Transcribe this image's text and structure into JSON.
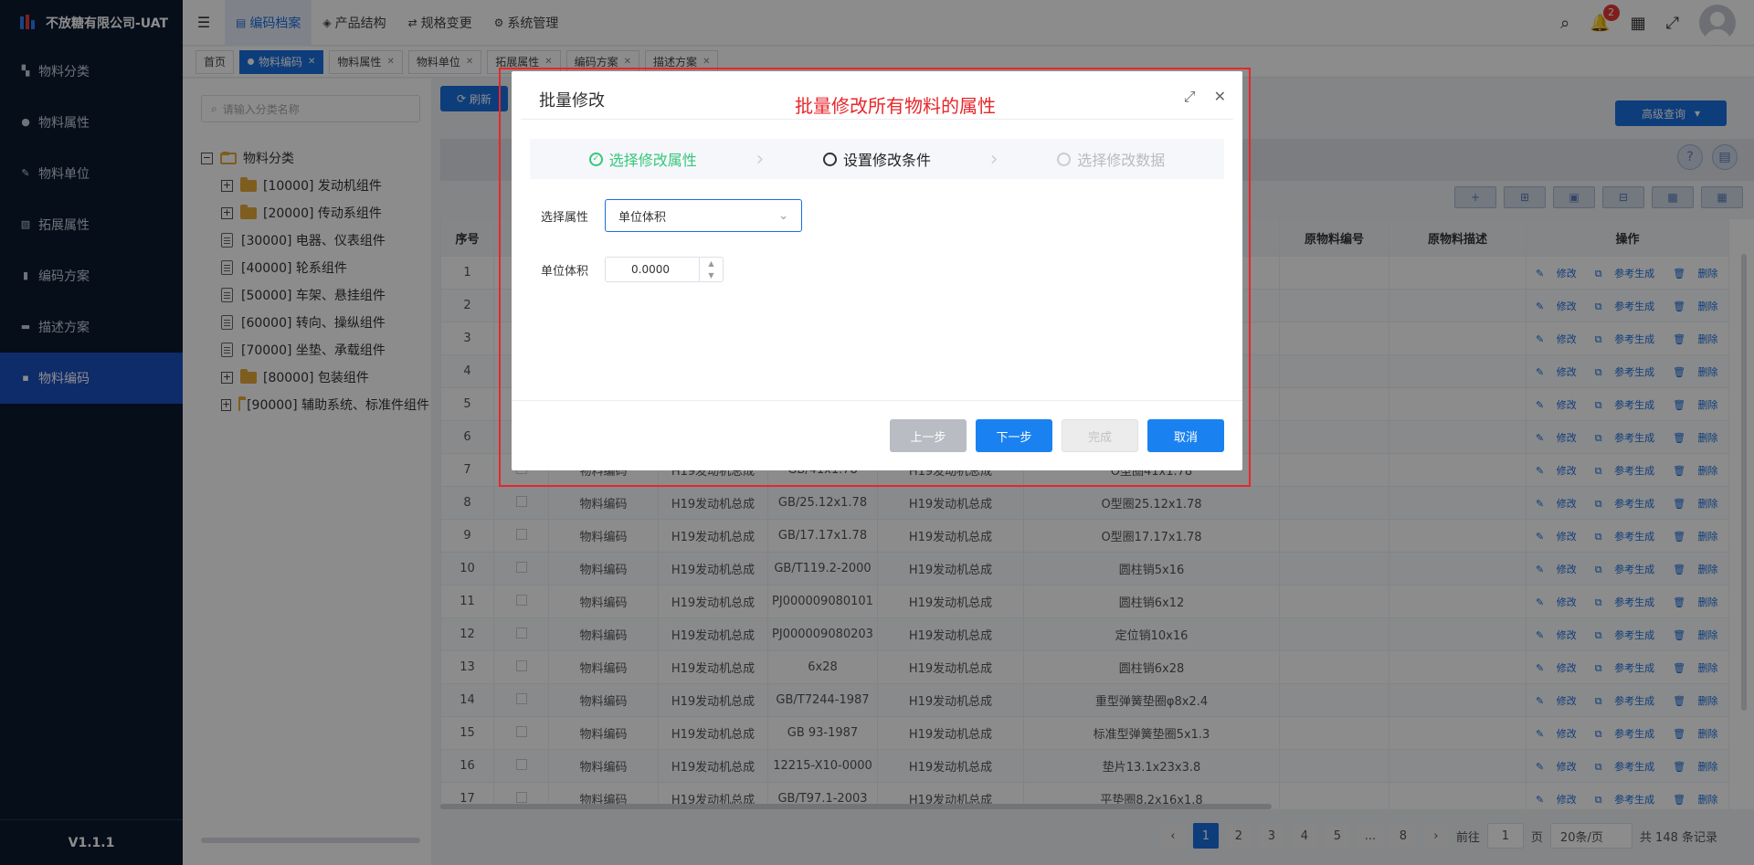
{
  "app": {
    "name": "不放糖有限公司-UAT",
    "version": "V1.1.1"
  },
  "sidebar": {
    "items": [
      {
        "label": "物料分类",
        "icon": "grid-icon"
      },
      {
        "label": "物料属性",
        "icon": "info-icon"
      },
      {
        "label": "物料单位",
        "icon": "ruler-icon"
      },
      {
        "label": "拓展属性",
        "icon": "extend-icon"
      },
      {
        "label": "编码方案",
        "icon": "code-icon"
      },
      {
        "label": "描述方案",
        "icon": "desc-icon"
      },
      {
        "label": "物料编码",
        "icon": "doc-icon",
        "active": true
      }
    ]
  },
  "topnav": {
    "tabs": [
      {
        "label": "编码档案",
        "active": true
      },
      {
        "label": "产品结构"
      },
      {
        "label": "规格变更"
      },
      {
        "label": "系统管理"
      }
    ],
    "notification_count": "2"
  },
  "tags": [
    {
      "label": "首页"
    },
    {
      "label": "物料编码",
      "active": true
    },
    {
      "label": "物料属性"
    },
    {
      "label": "物料单位"
    },
    {
      "label": "拓展属性"
    },
    {
      "label": "编码方案"
    },
    {
      "label": "描述方案"
    }
  ],
  "tree": {
    "search_placeholder": "请输入分类名称",
    "root": "物料分类",
    "nodes": [
      {
        "label": "[10000] 发动机组件",
        "type": "folder"
      },
      {
        "label": "[20000] 传动系组件",
        "type": "folder"
      },
      {
        "label": "[30000] 电器、仪表组件",
        "type": "file"
      },
      {
        "label": "[40000] 轮系组件",
        "type": "file"
      },
      {
        "label": "[50000] 车架、悬挂组件",
        "type": "file"
      },
      {
        "label": "[60000] 转向、操纵组件",
        "type": "file"
      },
      {
        "label": "[70000] 坐垫、承载组件",
        "type": "file"
      },
      {
        "label": "[80000] 包装组件",
        "type": "folder"
      },
      {
        "label": "[90000] 辅助系统、标准件组件",
        "type": "folder"
      }
    ]
  },
  "toolbar": {
    "refresh": "刷新",
    "advanced_query": "高级查询"
  },
  "table": {
    "columns": [
      "序号",
      "",
      "",
      "",
      "",
      "",
      "",
      "原物料编号",
      "原物料描述",
      "操作"
    ],
    "op_labels": [
      "修改",
      "参考生成",
      "删除"
    ],
    "rows": [
      {
        "no": "1",
        "c1": "",
        "c2": "",
        "c3": "",
        "c4": "",
        "c5": ""
      },
      {
        "no": "2",
        "c1": "",
        "c2": "",
        "c3": "",
        "c4": "",
        "c5": ""
      },
      {
        "no": "3",
        "c1": "",
        "c2": "",
        "c3": "",
        "c4": "",
        "c5": ""
      },
      {
        "no": "4",
        "c1": "",
        "c2": "",
        "c3": "",
        "c4": "",
        "c5": ""
      },
      {
        "no": "5",
        "c1": "",
        "c2": "",
        "c3": "",
        "c4": "",
        "c5": ""
      },
      {
        "no": "6",
        "c1": "",
        "c2": "",
        "c3": "",
        "c4": "",
        "c5": ""
      },
      {
        "no": "7",
        "c1": "物料编码",
        "c2": "H19发动机总成",
        "c3": "GB/41x1.78",
        "c4": "H19发动机总成",
        "c5": "O型圈41x1.78"
      },
      {
        "no": "8",
        "c1": "物料编码",
        "c2": "H19发动机总成",
        "c3": "GB/25.12x1.78",
        "c4": "H19发动机总成",
        "c5": "O型圈25.12x1.78"
      },
      {
        "no": "9",
        "c1": "物料编码",
        "c2": "H19发动机总成",
        "c3": "GB/17.17x1.78",
        "c4": "H19发动机总成",
        "c5": "O型圈17.17x1.78"
      },
      {
        "no": "10",
        "c1": "物料编码",
        "c2": "H19发动机总成",
        "c3": "GB/T119.2-2000",
        "c4": "H19发动机总成",
        "c5": "圆柱销5x16"
      },
      {
        "no": "11",
        "c1": "物料编码",
        "c2": "H19发动机总成",
        "c3": "PJ000009080101",
        "c4": "H19发动机总成",
        "c5": "圆柱销6x12"
      },
      {
        "no": "12",
        "c1": "物料编码",
        "c2": "H19发动机总成",
        "c3": "PJ000009080203",
        "c4": "H19发动机总成",
        "c5": "定位销10x16"
      },
      {
        "no": "13",
        "c1": "物料编码",
        "c2": "H19发动机总成",
        "c3": "6x28",
        "c4": "H19发动机总成",
        "c5": "圆柱销6x28"
      },
      {
        "no": "14",
        "c1": "物料编码",
        "c2": "H19发动机总成",
        "c3": "GB/T7244-1987",
        "c4": "H19发动机总成",
        "c5": "重型弹簧垫圈φ8x2.4"
      },
      {
        "no": "15",
        "c1": "物料编码",
        "c2": "H19发动机总成",
        "c3": "GB 93-1987",
        "c4": "H19发动机总成",
        "c5": "标准型弹簧垫圈5x1.3"
      },
      {
        "no": "16",
        "c1": "物料编码",
        "c2": "H19发动机总成",
        "c3": "12215-X10-0000",
        "c4": "H19发动机总成",
        "c5": "垫片13.1x23x3.8"
      },
      {
        "no": "17",
        "c1": "物料编码",
        "c2": "H19发动机总成",
        "c3": "GB/T97.1-2003",
        "c4": "H19发动机总成",
        "c5": "平垫圈8.2x16x1.8"
      }
    ]
  },
  "pager": {
    "pages": [
      "1",
      "2",
      "3",
      "4",
      "5",
      "...",
      "8"
    ],
    "goto_prefix": "前往",
    "goto_value": "1",
    "goto_suffix": "页",
    "page_size": "20条/页",
    "total": "共 148 条记录"
  },
  "modal": {
    "title": "批量修改",
    "hint": "批量修改所有物料的属性",
    "steps": [
      {
        "label": "选择修改属性",
        "state": "done"
      },
      {
        "label": "设置修改条件",
        "state": "current"
      },
      {
        "label": "选择修改数据",
        "state": "wait"
      }
    ],
    "select_label": "选择属性",
    "select_value": "单位体积",
    "field_label": "单位体积",
    "field_value": "0.0000",
    "buttons": {
      "prev": "上一步",
      "next": "下一步",
      "finish": "完成",
      "cancel": "取消"
    }
  },
  "colors": {
    "primary": "#1a6fe0",
    "sidebar_bg": "#0b1a30",
    "done_green": "#36c77a",
    "hint_red": "#e8262a"
  }
}
